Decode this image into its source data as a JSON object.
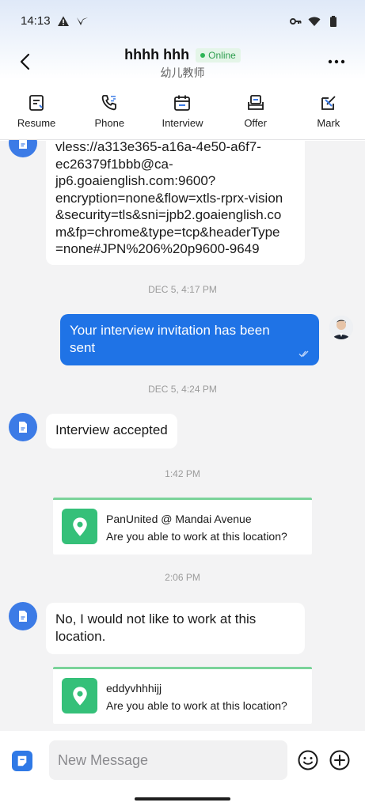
{
  "status_bar": {
    "time": "14:13"
  },
  "header": {
    "contact_name": "hhhh hhh",
    "online_label": "Online",
    "subtitle": "幼儿教师"
  },
  "actions": [
    {
      "label": "Resume",
      "icon": "resume-icon"
    },
    {
      "label": "Phone",
      "icon": "phone-icon"
    },
    {
      "label": "Interview",
      "icon": "calendar-icon"
    },
    {
      "label": "Offer",
      "icon": "offer-icon"
    },
    {
      "label": "Mark",
      "icon": "mark-icon"
    }
  ],
  "messages": {
    "vless_lines": [
      "vless://a313e365-a16a-4e50-a6f7-",
      "ec26379f1bbb@ca-",
      "jp6.goaienglish.com:9600?",
      "encryption=none&flow=xtls-rprx-vision",
      "&security=tls&sni=jpb2.goaienglish.co",
      "m&fp=chrome&type=tcp&headerType",
      "=none#JPN%206%20p9600-9649"
    ],
    "ts1": "DEC 5, 4:17 PM",
    "invite_sent": "Your interview invitation has been sent",
    "ts2": "DEC 5, 4:24 PM",
    "interview_accepted": "Interview accepted",
    "ts3": "1:42 PM",
    "loc1_title": "PanUnited @ Mandai Avenue",
    "loc1_question": "Are you able to work at this location?",
    "ts4": "2:06 PM",
    "decline": "No, I would not like to work at this location.",
    "loc2_title": "eddyvhhhijj",
    "loc2_question": "Are you able to work at this location?"
  },
  "input": {
    "placeholder": "New Message"
  },
  "colors": {
    "accent_blue": "#1f73e6",
    "online_green": "#2e9e4f",
    "location_green": "#35c079"
  }
}
